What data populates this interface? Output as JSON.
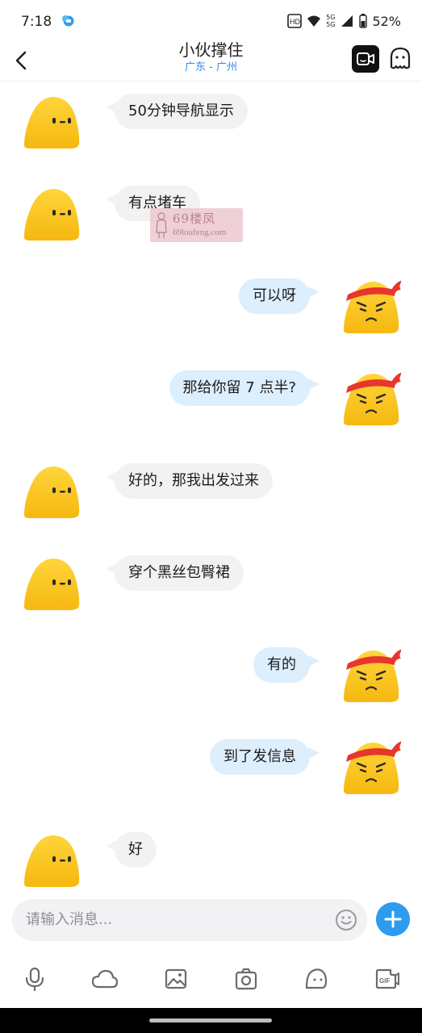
{
  "status_bar": {
    "time": "7:18",
    "battery": "52%",
    "signal_label_top": "5G",
    "signal_label_bottom": "5G"
  },
  "header": {
    "title": "小伙撑住",
    "subtitle": "广东 - 广州"
  },
  "messages": [
    {
      "side": "in",
      "text": "50分钟导航显示"
    },
    {
      "side": "in",
      "text": "有点堵车"
    },
    {
      "side": "out",
      "text": "可以呀"
    },
    {
      "side": "out",
      "text": "那给你留 7 点半?"
    },
    {
      "side": "in",
      "text": "好的，那我出发过来"
    },
    {
      "side": "in",
      "text": "穿个黑丝包臀裙"
    },
    {
      "side": "out",
      "text": "有的"
    },
    {
      "side": "out",
      "text": "到了发信息"
    },
    {
      "side": "in",
      "text": "好"
    }
  ],
  "watermark": {
    "main": "69楼凤",
    "sub": "69loufeng.com"
  },
  "composer": {
    "placeholder": "请输入消息..."
  },
  "toolbar": {
    "items": [
      "mic-icon",
      "cloud-icon",
      "image-icon",
      "camera-icon",
      "sticker-icon",
      "gif-icon"
    ],
    "gif_label": "GIF"
  },
  "colors": {
    "accent": "#2d9cf0",
    "subtitle": "#2d8cf0",
    "incoming_bubble": "#f2f2f2",
    "outgoing_bubble": "#ddeefc",
    "avatar_yellow": "#f6c21c",
    "headband_red": "#e8362c"
  }
}
